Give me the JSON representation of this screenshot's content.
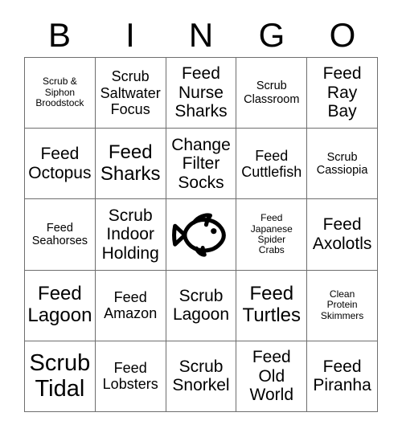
{
  "card": {
    "title": "BINGO",
    "header_letters": [
      "B",
      "I",
      "N",
      "G",
      "O"
    ],
    "colors": {
      "background": "#ffffff",
      "text": "#000000",
      "grid_line": "#6e6e6e"
    },
    "grid": {
      "columns": 5,
      "rows": 5,
      "cells": [
        {
          "text": "Scrub &\nSiphon\nBroodstock",
          "size": "fs-xs",
          "type": "text"
        },
        {
          "text": "Scrub\nSaltwater\nFocus",
          "size": "fs-md",
          "type": "text"
        },
        {
          "text": "Feed\nNurse\nSharks",
          "size": "fs-lg",
          "type": "text"
        },
        {
          "text": "Scrub\nClassroom",
          "size": "fs-sm",
          "type": "text"
        },
        {
          "text": "Feed\nRay\nBay",
          "size": "fs-lg",
          "type": "text"
        },
        {
          "text": "Feed\nOctopus",
          "size": "fs-lg",
          "type": "text"
        },
        {
          "text": "Feed\nSharks",
          "size": "fs-xl",
          "type": "text"
        },
        {
          "text": "Change\nFilter\nSocks",
          "size": "fs-lg",
          "type": "text"
        },
        {
          "text": "Feed\nCuttlefish",
          "size": "fs-md",
          "type": "text"
        },
        {
          "text": "Scrub\nCassiopia",
          "size": "fs-sm",
          "type": "text"
        },
        {
          "text": "Feed\nSeahorses",
          "size": "fs-sm",
          "type": "text"
        },
        {
          "text": "Scrub\nIndoor\nHolding",
          "size": "fs-lg",
          "type": "text"
        },
        {
          "text": "",
          "size": "fs-md",
          "type": "free-space",
          "icon": "fish-icon"
        },
        {
          "text": "Feed\nJapanese\nSpider\nCrabs",
          "size": "fs-xs",
          "type": "text"
        },
        {
          "text": "Feed\nAxolotls",
          "size": "fs-lg",
          "type": "text"
        },
        {
          "text": "Feed\nLagoon",
          "size": "fs-xl",
          "type": "text"
        },
        {
          "text": "Feed\nAmazon",
          "size": "fs-md",
          "type": "text"
        },
        {
          "text": "Scrub\nLagoon",
          "size": "fs-lg",
          "type": "text"
        },
        {
          "text": "Feed\nTurtles",
          "size": "fs-xl",
          "type": "text"
        },
        {
          "text": "Clean\nProtein\nSkimmers",
          "size": "fs-xs",
          "type": "text"
        },
        {
          "text": "Scrub\nTidal",
          "size": "fs-xxl",
          "type": "text"
        },
        {
          "text": "Feed\nLobsters",
          "size": "fs-md",
          "type": "text"
        },
        {
          "text": "Scrub\nSnorkel",
          "size": "fs-lg",
          "type": "text"
        },
        {
          "text": "Feed\nOld\nWorld",
          "size": "fs-lg",
          "type": "text"
        },
        {
          "text": "Feed\nPiranha",
          "size": "fs-lg",
          "type": "text"
        }
      ]
    }
  }
}
